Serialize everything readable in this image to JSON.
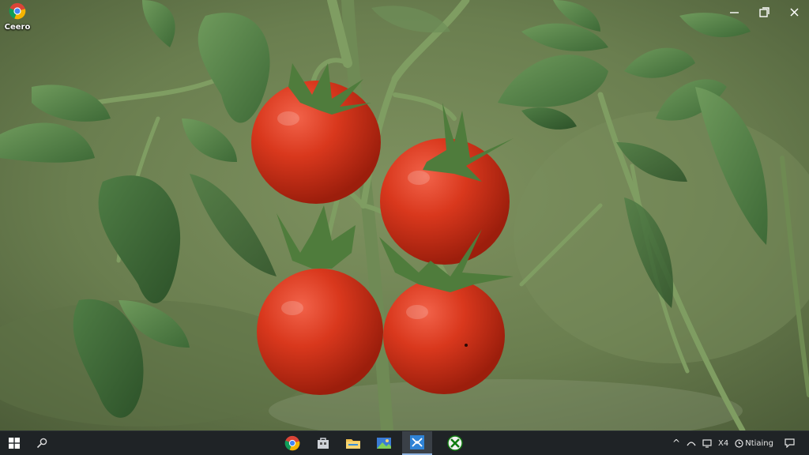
{
  "desktop": {
    "icons": [
      {
        "label": "Ceero",
        "icon": "chrome-icon"
      }
    ]
  },
  "window_controls": {
    "minimize": "minimize-icon",
    "restore": "restore-icon",
    "close": "close-icon"
  },
  "taskbar": {
    "left": [
      "windows-start-icon",
      "search-icon"
    ],
    "apps": [
      "chrome-icon",
      "store-icon",
      "file-explorer-icon",
      "photos-icon",
      "app-icon",
      "xbox-icon"
    ],
    "tray": {
      "chevron_label": "^",
      "ime_label": "X4",
      "status_text": "Ntiaing"
    }
  },
  "colors": {
    "taskbar_bg": "#1f2326",
    "active_indicator": "#8fb4e0",
    "background_green": "#5b6e45",
    "tomato_red": "#d8321b"
  }
}
